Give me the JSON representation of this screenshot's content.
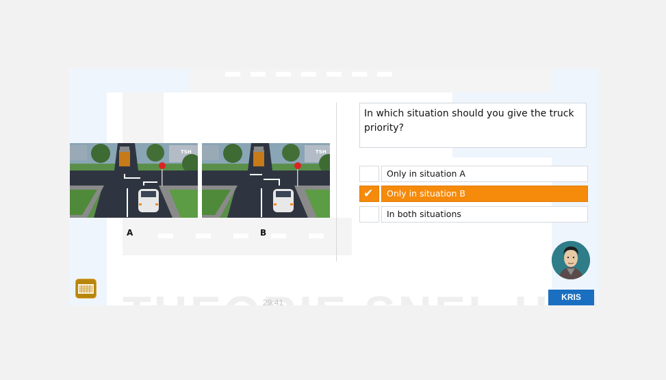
{
  "question": {
    "text": "In which situation should you give the truck priority?"
  },
  "situations": [
    {
      "label": "A",
      "image": "intersection-photo-truck-car-stop-sign"
    },
    {
      "label": "B",
      "image": "intersection-photo-truck-car-stop-sign"
    }
  ],
  "options": [
    {
      "label": "Only in situation A",
      "selected": false
    },
    {
      "label": "Only in situation B",
      "selected": true
    },
    {
      "label": "In both situations",
      "selected": false
    }
  ],
  "icons": {
    "check": "✔",
    "keyboard": "keyboard-icon"
  },
  "timer": "29:41",
  "instructor": {
    "name": "KRIS"
  },
  "watermark": {
    "text": "THEORIE SNEL HALEN",
    "logo": "TSH"
  },
  "colors": {
    "selected": "#f58a0b",
    "badge": "#1a6fc0",
    "keyboard": "#b8860b"
  }
}
